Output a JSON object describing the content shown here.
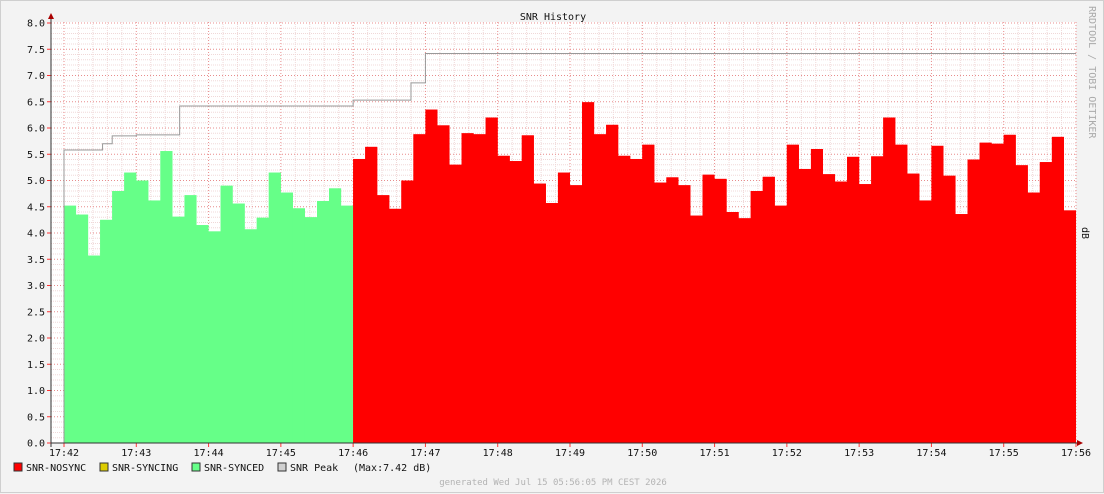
{
  "chart_data": {
    "type": "area",
    "title": "SNR History",
    "ylabel": "dB",
    "watermark": "RRDTOOL / TOBI OETIKER",
    "footer": "generated Wed Jul 15 05:56:05 PM CEST 2026",
    "ylim": [
      0,
      8
    ],
    "yticks": [
      "0.0",
      "0.5",
      "1.0",
      "1.5",
      "2.0",
      "2.5",
      "3.0",
      "3.5",
      "4.0",
      "4.5",
      "5.0",
      "5.5",
      "6.0",
      "6.5",
      "7.0",
      "7.5",
      "8.0"
    ],
    "xlim": [
      "17:42",
      "17:56"
    ],
    "xticks": [
      "17:42",
      "17:43",
      "17:44",
      "17:45",
      "17:46",
      "17:47",
      "17:48",
      "17:49",
      "17:50",
      "17:51",
      "17:52",
      "17:53",
      "17:54",
      "17:55",
      "17:56"
    ],
    "grid": true,
    "legend_position": "bottom-left",
    "step_seconds": 10,
    "x_start": "17:42:00",
    "series": [
      {
        "name": "SNR-SYNCED",
        "color": "#66ff88",
        "edge_color": "#55dd77",
        "start": "17:42:00",
        "values": [
          4.52,
          4.35,
          3.57,
          4.25,
          4.8,
          5.15,
          5.0,
          4.62,
          5.56,
          4.31,
          4.72,
          4.15,
          4.03,
          4.9,
          4.56,
          4.07,
          4.29,
          5.15,
          4.77,
          4.47,
          4.3,
          4.61,
          4.85,
          4.52
        ]
      },
      {
        "name": "SNR-NOSYNC",
        "color": "#ff0000",
        "edge_color": "#dd0000",
        "start": "17:46:00",
        "values": [
          5.41,
          5.64,
          4.72,
          4.46,
          5.0,
          5.88,
          6.35,
          6.05,
          5.3,
          5.9,
          5.88,
          6.2,
          5.47,
          5.37,
          5.86,
          4.94,
          4.57,
          5.15,
          4.91,
          6.49,
          5.88,
          6.06,
          5.47,
          5.41,
          5.68,
          4.96,
          5.06,
          4.91,
          4.33,
          5.11,
          5.03,
          4.4,
          4.28,
          4.8,
          5.07,
          4.52,
          5.68,
          5.22,
          5.6,
          5.12,
          4.98,
          5.45,
          4.93,
          5.46,
          6.2,
          5.68,
          5.13,
          4.62,
          5.66,
          5.09,
          4.36,
          5.4,
          5.72,
          5.7,
          5.87,
          5.29,
          4.77,
          5.35,
          5.83,
          4.43
        ]
      },
      {
        "name": "SNR-SYNCING",
        "color": "#ddcc00",
        "edge_color": "#aa9900",
        "values": []
      },
      {
        "name": "SNR Peak",
        "color": "#b8b8b8",
        "edge_color": "#999999",
        "steps": [
          {
            "t": "17:42:00",
            "v": 5.58
          },
          {
            "t": "17:42:30",
            "v": 5.58
          },
          {
            "t": "17:42:32",
            "v": 5.7
          },
          {
            "t": "17:42:40",
            "v": 5.85
          },
          {
            "t": "17:43:00",
            "v": 5.87
          },
          {
            "t": "17:43:20",
            "v": 5.87
          },
          {
            "t": "17:43:36",
            "v": 6.42
          },
          {
            "t": "17:46:00",
            "v": 6.53
          },
          {
            "t": "17:46:48",
            "v": 6.86
          },
          {
            "t": "17:47:00",
            "v": 7.42
          },
          {
            "t": "17:56:00",
            "v": 7.42
          }
        ]
      }
    ]
  },
  "legend": [
    {
      "label": "SNR-NOSYNC",
      "color": "#ff0000"
    },
    {
      "label": "SNR-SYNCING",
      "color": "#ddcc00"
    },
    {
      "label": "SNR-SYNCED",
      "color": "#66ff88"
    },
    {
      "label": "SNR Peak",
      "color": "#d0d0d0"
    }
  ],
  "peak_note": "(Max:7.42 dB)"
}
